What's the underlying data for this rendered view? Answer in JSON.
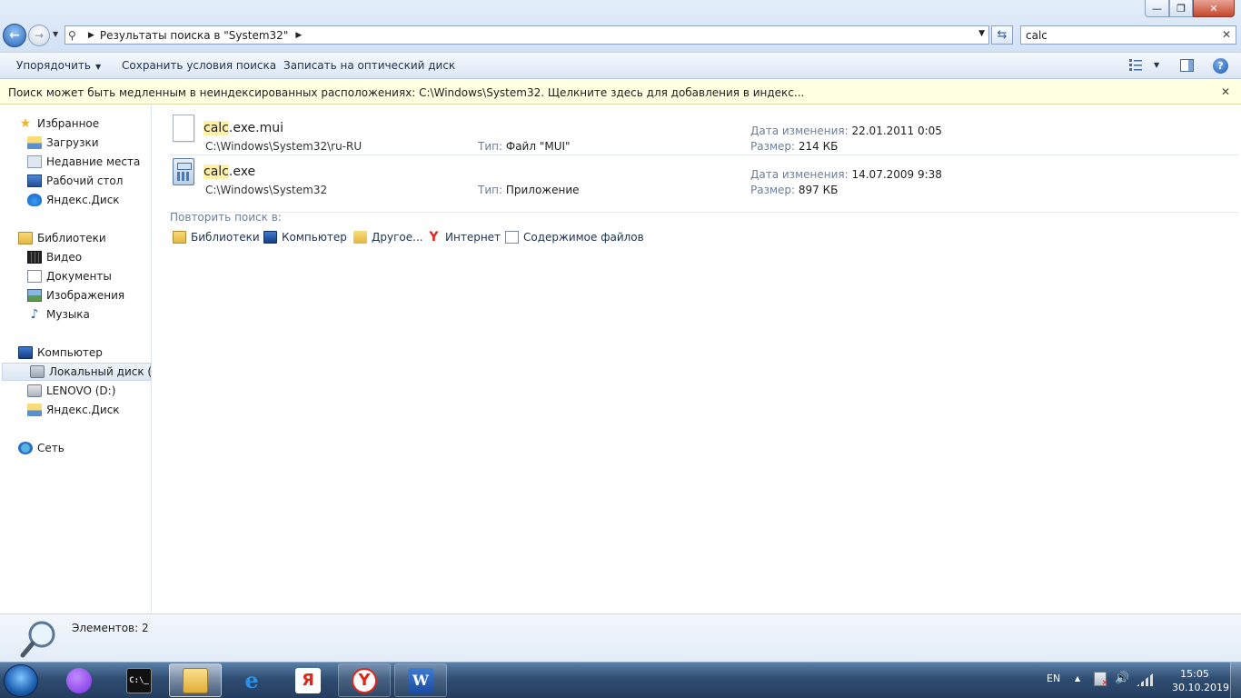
{
  "window": {
    "min_glyph": "—",
    "max_glyph": "❐",
    "close_glyph": "✕"
  },
  "address": {
    "path_root": "Результаты поиска в \"System32\"",
    "sep1": "▶",
    "sep2": "▶",
    "dropdown": "▼"
  },
  "search": {
    "value": "calc",
    "clear_glyph": "✕"
  },
  "commands": {
    "organize": "Упорядочить",
    "organize_caret": "▼",
    "save_search": "Сохранить условия поиска",
    "burn": "Записать на оптический диск",
    "view_caret": "▼",
    "help": "?"
  },
  "infobar": {
    "text": "Поиск может быть медленным в неиндексированных расположениях: C:\\Windows\\System32. Щелкните здесь для добавления в индекс...",
    "close": "✕"
  },
  "nav": {
    "favorites": "Избранное",
    "downloads": "Загрузки",
    "recent": "Недавние места",
    "desktop": "Рабочий стол",
    "yadisk1": "Яндекс.Диск",
    "libraries": "Библиотеки",
    "video": "Видео",
    "documents": "Документы",
    "images": "Изображения",
    "music": "Музыка",
    "computer": "Компьютер",
    "local_c": "Локальный диск (C:)",
    "lenovo_d": "LENOVO (D:)",
    "yadisk2": "Яндекс.Диск",
    "network": "Сеть"
  },
  "results": [
    {
      "match": "calc",
      "rest": ".exe.mui",
      "path": "C:\\Windows\\System32\\ru-RU",
      "type_label": "Тип:",
      "type": "Файл \"MUI\"",
      "date_label": "Дата изменения:",
      "date": "22.01.2011 0:05",
      "size_label": "Размер:",
      "size": "214 КБ"
    },
    {
      "match": "calc",
      "rest": ".exe",
      "path": "C:\\Windows\\System32",
      "type_label": "Тип:",
      "type": "Приложение",
      "date_label": "Дата изменения:",
      "date": "14.07.2009 9:38",
      "size_label": "Размер:",
      "size": "897 КБ"
    }
  ],
  "search_again": {
    "label": "Повторить поиск в:",
    "libraries": "Библиотеки",
    "computer": "Компьютер",
    "other": "Другое...",
    "internet": "Интернет",
    "file_contents": "Содержимое файлов"
  },
  "details": {
    "count": "Элементов: 2"
  },
  "taskbar": {
    "cmd_glyph": "C:\\_",
    "ie_glyph": "e",
    "ya_glyph": "Я",
    "yabrowser_glyph": "Y",
    "word_glyph": "W"
  },
  "tray": {
    "lang": "EN",
    "up": "▲",
    "volume": "🔊",
    "time": "15:05",
    "date": "30.10.2019"
  }
}
